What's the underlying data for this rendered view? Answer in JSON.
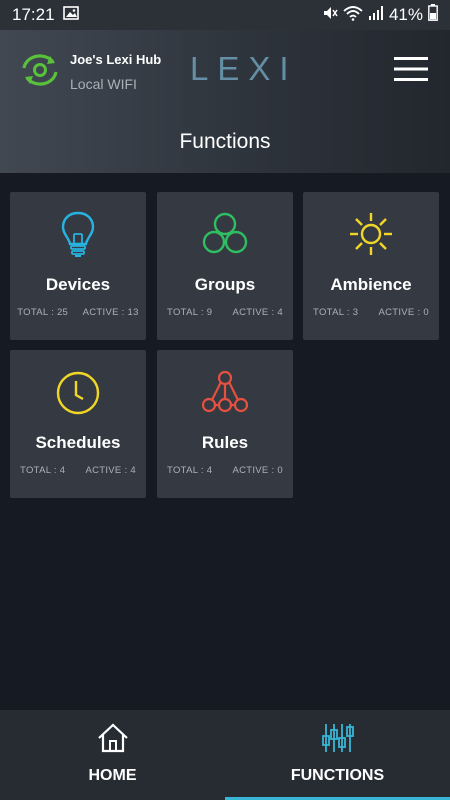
{
  "status_bar": {
    "time": "17:21",
    "battery": "41%"
  },
  "header": {
    "hub_name": "Joe's Lexi Hub",
    "connection": "Local WIFI",
    "brand": "LEXI",
    "title": "Functions"
  },
  "functions": [
    {
      "label": "Devices",
      "total": "TOTAL : 25",
      "active": "ACTIVE : 13",
      "icon": "lightbulb-icon",
      "color": "#27b3e0"
    },
    {
      "label": "Groups",
      "total": "TOTAL : 9",
      "active": "ACTIVE : 4",
      "icon": "groups-circles-icon",
      "color": "#2fbf62"
    },
    {
      "label": "Ambience",
      "total": "TOTAL : 3",
      "active": "ACTIVE : 0",
      "icon": "sun-icon",
      "color": "#f2d626"
    },
    {
      "label": "Schedules",
      "total": "TOTAL : 4",
      "active": "ACTIVE : 4",
      "icon": "clock-icon",
      "color": "#f2d626"
    },
    {
      "label": "Rules",
      "total": "TOTAL : 4",
      "active": "ACTIVE : 0",
      "icon": "rules-nodes-icon",
      "color": "#e6503f"
    }
  ],
  "nav": {
    "home": "HOME",
    "functions": "FUNCTIONS",
    "active": "functions",
    "accent": "#38b6d6"
  }
}
